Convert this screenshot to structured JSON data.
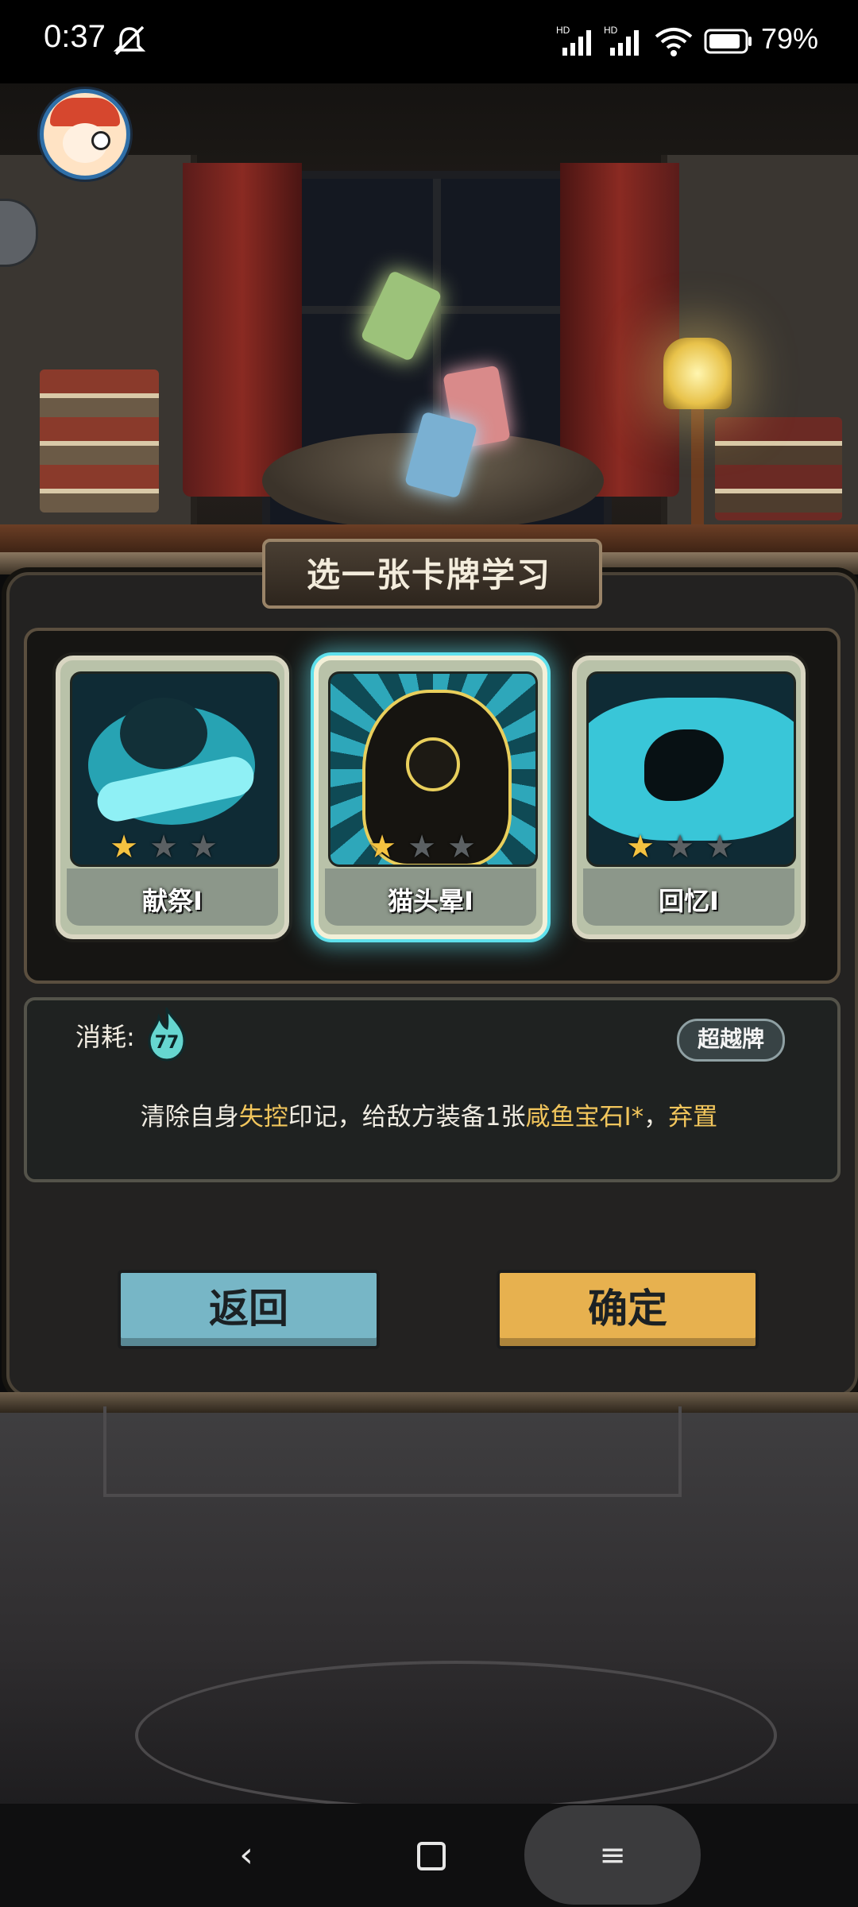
{
  "status_bar": {
    "time": "0:37",
    "battery": "79%",
    "icons": [
      "mute-icon",
      "signal-hd-icon",
      "signal-hd-icon",
      "wifi-icon",
      "battery-icon"
    ]
  },
  "dialog": {
    "title": "选一张卡牌学习",
    "cards": [
      {
        "name": "献祭I",
        "stars_filled": 1,
        "stars_total": 3,
        "selected": false
      },
      {
        "name": "猫头晕I",
        "stars_filled": 1,
        "stars_total": 3,
        "selected": true
      },
      {
        "name": "回忆I",
        "stars_filled": 1,
        "stars_total": 3,
        "selected": false
      }
    ],
    "cost_label": "消耗:",
    "cost_value": "77",
    "badge": "超越牌",
    "description": {
      "p1": "清除自身",
      "h1": "失控",
      "p2": "印记，给敌方装备1张",
      "h2": "咸鱼宝石I*",
      "p3": "，",
      "h3": "弃置"
    },
    "back_button": "返回",
    "confirm_button": "确定"
  },
  "nav": {
    "back": "‹",
    "menu": "≡"
  },
  "colors": {
    "highlight": "#f2c65c",
    "back_button": "#77b6c6",
    "confirm_button": "#e7b14f",
    "selected_glow": "#5fe0ec"
  }
}
